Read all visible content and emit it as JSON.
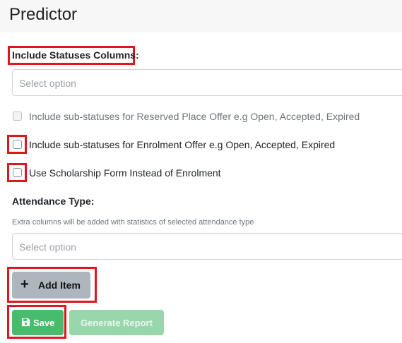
{
  "page": {
    "title": "Predictor"
  },
  "statuses": {
    "label": "Include Statuses Columns:",
    "placeholder": "Select option"
  },
  "checkboxes": [
    {
      "label": "Include sub-statuses for Reserved Place Offer e.g Open, Accepted, Expired",
      "disabled": true,
      "checked": false
    },
    {
      "label": "Include sub-statuses for Enrolment Offer e.g Open, Accepted, Expired",
      "disabled": false,
      "checked": false
    },
    {
      "label": "Use Scholarship Form Instead of Enrolment",
      "disabled": false,
      "checked": false
    }
  ],
  "attendance": {
    "label": "Attendance Type:",
    "hint": "Extra columns will be added with statistics of selected attendance type",
    "placeholder": "Select option"
  },
  "buttons": {
    "add_item": "Add Item",
    "save": "Save",
    "generate_report": "Generate Report"
  },
  "icons": {
    "add": "plus-icon",
    "save": "floppy-disk-icon"
  },
  "colors": {
    "highlight": "#e0161c",
    "save_green": "#48bb6c",
    "generate_disabled_green": "#98d7ab",
    "add_gray": "#adb5bd"
  }
}
